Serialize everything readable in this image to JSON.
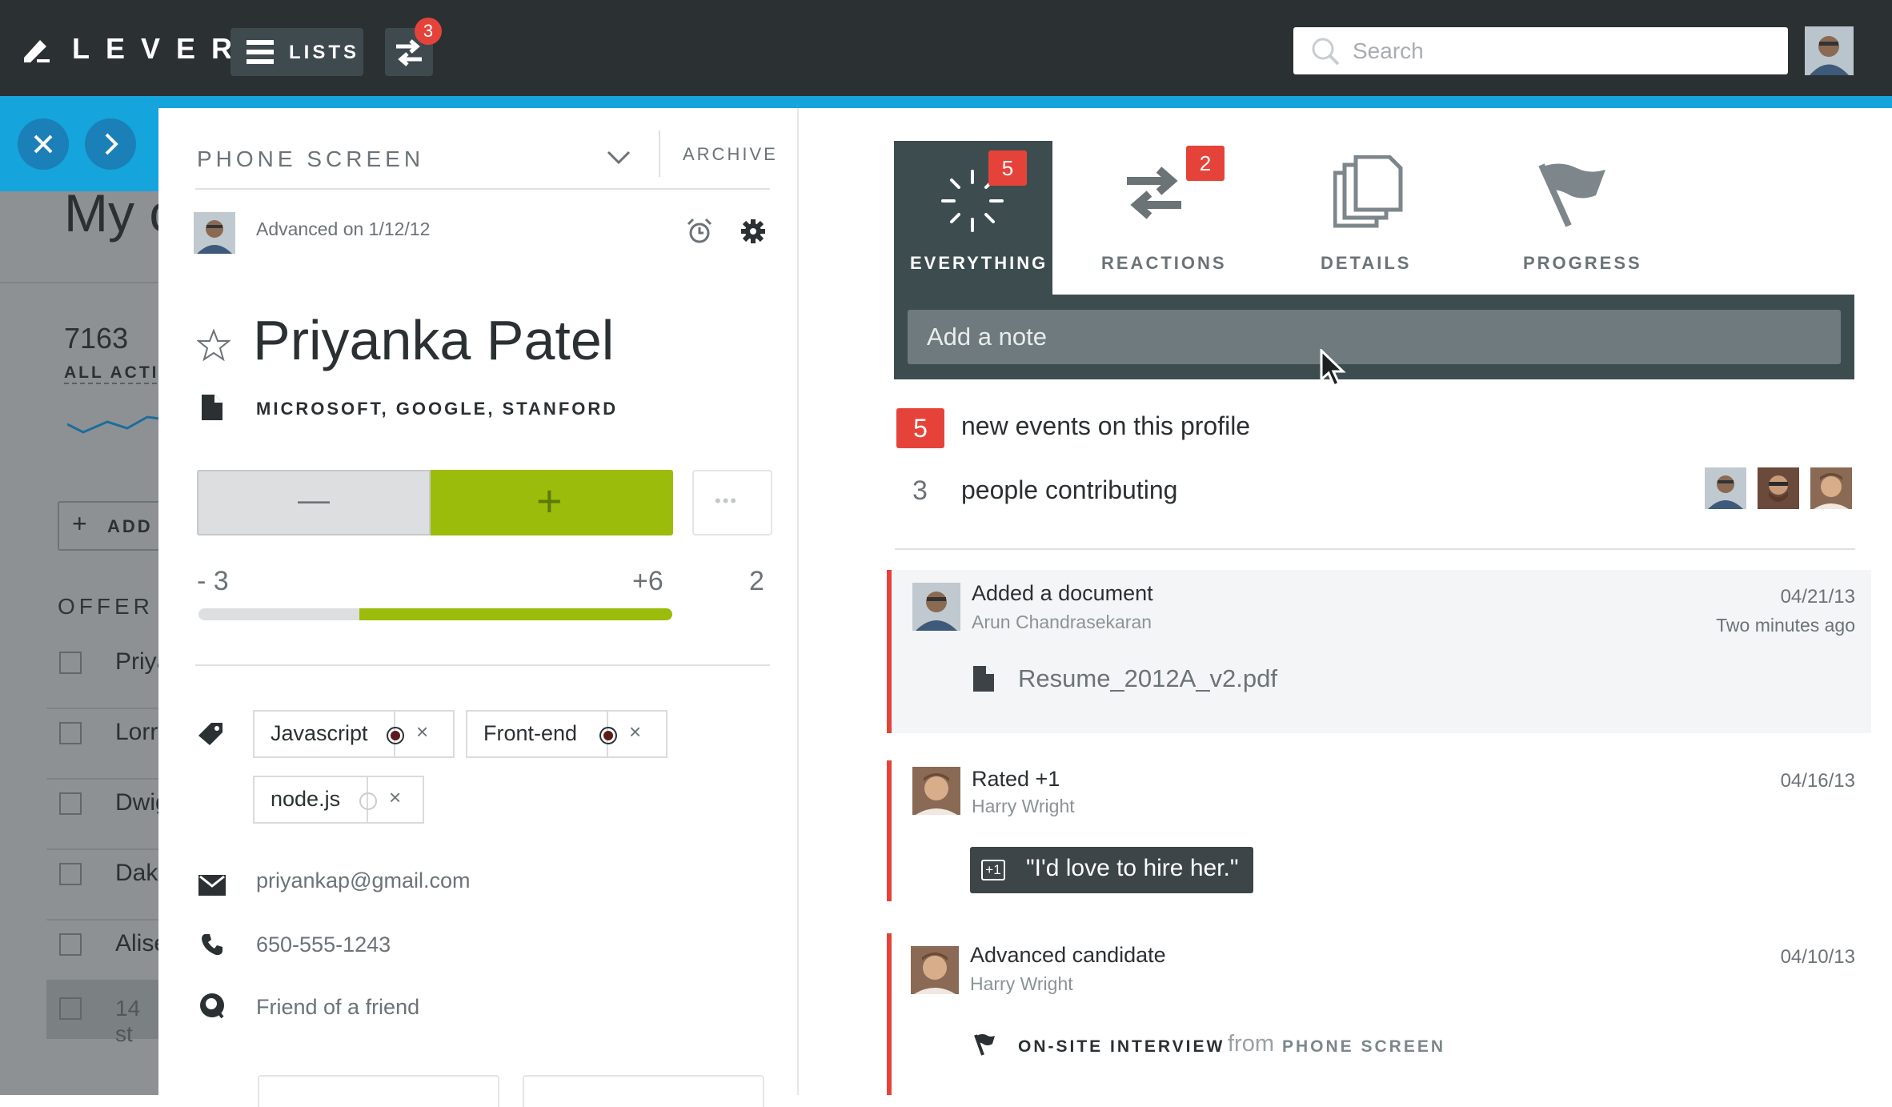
{
  "topbar": {
    "logo": "LEVER",
    "lists_label": "LISTS",
    "swap_badge": "3",
    "search_placeholder": "Search"
  },
  "left_panel": {
    "heading": "My c",
    "count": "7163",
    "count_label": "ALL ACTIV",
    "add_label": "ADD",
    "section": "OFFER",
    "rows": [
      "Priya",
      "Lorri",
      "Dwig",
      "Dako",
      "Alise",
      "14 st"
    ]
  },
  "candidate": {
    "stage": "PHONE SCREEN",
    "archive_label": "ARCHIVE",
    "advanced_on": "Advanced on 1/12/12",
    "name": "Priyanka Patel",
    "companies": "MICROSOFT, GOOGLE, STANFORD",
    "vote_minus": "—",
    "vote_plus": "+",
    "vote_more": "•••",
    "score_neg": "- 3",
    "score_pos": "+6",
    "score_total": "2",
    "score_fraction": 0.66,
    "tags": [
      {
        "label": "Javascript",
        "marked": true
      },
      {
        "label": "Front-end",
        "marked": true
      },
      {
        "label": "node.js",
        "marked": false
      }
    ],
    "email": "priyankap@gmail.com",
    "phone": "650-555-1243",
    "source": "Friend of a friend"
  },
  "tabs": [
    {
      "label": "EVERYTHING",
      "badge": "5",
      "active": true
    },
    {
      "label": "REACTIONS",
      "badge": "2",
      "active": false
    },
    {
      "label": "DETAILS",
      "badge": "",
      "active": false
    },
    {
      "label": "PROGRESS",
      "badge": "",
      "active": false
    }
  ],
  "note_placeholder": "Add a note",
  "summary": {
    "events_count": "5",
    "events_text": "new events on this profile",
    "people_count": "3",
    "people_text": "people contributing"
  },
  "feed": [
    {
      "title": "Added a document",
      "author": "Arun Chandrasekaran",
      "date": "04/21/13",
      "relative": "Two minutes ago",
      "file": "Resume_2012A_v2.pdf"
    },
    {
      "title": "Rated +1",
      "author": "Harry Wright",
      "date": "04/16/13",
      "rating": "+1",
      "quote": "\"I'd love to hire her.\""
    },
    {
      "title": "Advanced candidate",
      "author": "Harry Wright",
      "date": "04/10/13",
      "to_stage": "ON-SITE INTERVIEW",
      "from_word": "from",
      "from_stage": "PHONE SCREEN"
    }
  ],
  "colors": {
    "accent_blue": "#15a4dc",
    "positive_green": "#9bbc0a",
    "alert_red": "#e5433a",
    "dark": "#2b3033"
  }
}
